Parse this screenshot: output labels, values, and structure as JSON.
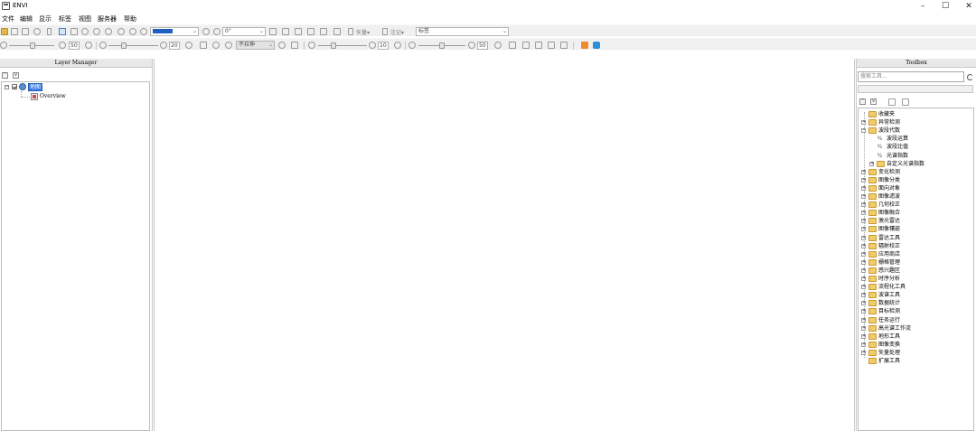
{
  "window": {
    "title": "ENVI",
    "minimize": "–",
    "maximize": "☐",
    "close": "✕"
  },
  "menu": [
    {
      "label": "文件"
    },
    {
      "label": "编辑"
    },
    {
      "label": "显示"
    },
    {
      "label": "标签"
    },
    {
      "label": "视图"
    },
    {
      "label": "服务器"
    },
    {
      "label": "帮助"
    }
  ],
  "toolbar1": {
    "rotation_value": "0°",
    "vector_label": "矢量▾",
    "annotation_label": "注记▾",
    "annotation_type_value": "标签"
  },
  "toolbar2": {
    "brightness_value": "50",
    "contrast_value": "20",
    "stretch_value": "不拉伸",
    "sharpen_value": "10",
    "transparency_value": "50"
  },
  "layer_manager": {
    "title": "Layer Manager",
    "root_label": "地图",
    "overview_label": "Overview"
  },
  "toolbox": {
    "title": "Toolbox",
    "search_placeholder": "搜索工具...",
    "items": [
      {
        "label": "收藏夹",
        "type": "folder",
        "level": 0,
        "expander": ""
      },
      {
        "label": "异常检测",
        "type": "folder",
        "level": 0,
        "expander": "+"
      },
      {
        "label": "波段代数",
        "type": "folder",
        "level": 0,
        "expander": "−"
      },
      {
        "label": "波段运算",
        "type": "tool",
        "level": 1,
        "expander": ""
      },
      {
        "label": "波段比值",
        "type": "tool",
        "level": 1,
        "expander": ""
      },
      {
        "label": "光谱指数",
        "type": "tool",
        "level": 1,
        "expander": ""
      },
      {
        "label": "自定义光谱指数",
        "type": "folder",
        "level": 1,
        "expander": "+"
      },
      {
        "label": "变化检测",
        "type": "folder",
        "level": 0,
        "expander": "+"
      },
      {
        "label": "图像分类",
        "type": "folder",
        "level": 0,
        "expander": "+"
      },
      {
        "label": "面向对象",
        "type": "folder",
        "level": 0,
        "expander": "+"
      },
      {
        "label": "图像滤波",
        "type": "folder",
        "level": 0,
        "expander": "+"
      },
      {
        "label": "几何校正",
        "type": "folder",
        "level": 0,
        "expander": "+"
      },
      {
        "label": "图像融合",
        "type": "folder",
        "level": 0,
        "expander": "+"
      },
      {
        "label": "激光雷达",
        "type": "folder",
        "level": 0,
        "expander": "+"
      },
      {
        "label": "图像镶嵌",
        "type": "folder",
        "level": 0,
        "expander": "+"
      },
      {
        "label": "雷达工具",
        "type": "folder",
        "level": 0,
        "expander": "+"
      },
      {
        "label": "辐射校正",
        "type": "folder",
        "level": 0,
        "expander": "+"
      },
      {
        "label": "应用商店",
        "type": "folder",
        "level": 0,
        "expander": "+"
      },
      {
        "label": "栅格管理",
        "type": "folder",
        "level": 0,
        "expander": "+"
      },
      {
        "label": "感兴趣区",
        "type": "folder",
        "level": 0,
        "expander": "+"
      },
      {
        "label": "时序分析",
        "type": "folder",
        "level": 0,
        "expander": "+"
      },
      {
        "label": "流程化工具",
        "type": "folder",
        "level": 0,
        "expander": "+"
      },
      {
        "label": "波谱工具",
        "type": "folder",
        "level": 0,
        "expander": "+"
      },
      {
        "label": "数据统计",
        "type": "folder",
        "level": 0,
        "expander": "+"
      },
      {
        "label": "目标检测",
        "type": "folder",
        "level": 0,
        "expander": "+"
      },
      {
        "label": "任务运行",
        "type": "folder",
        "level": 0,
        "expander": "+"
      },
      {
        "label": "高光谱工作流",
        "type": "folder",
        "level": 0,
        "expander": "+"
      },
      {
        "label": "地形工具",
        "type": "folder",
        "level": 0,
        "expander": "+"
      },
      {
        "label": "图像变换",
        "type": "folder",
        "level": 0,
        "expander": "+"
      },
      {
        "label": "矢量处理",
        "type": "folder",
        "level": 0,
        "expander": "+"
      },
      {
        "label": "扩展工具",
        "type": "folder",
        "level": 0,
        "expander": ""
      }
    ]
  }
}
